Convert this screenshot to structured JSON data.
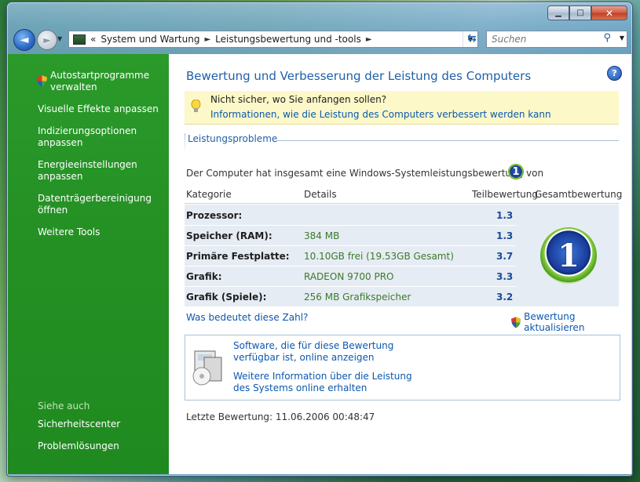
{
  "window": {
    "caption_minimize": "▁",
    "caption_maximize": "□",
    "caption_close": "✕"
  },
  "nav": {
    "back_glyph": "◄",
    "forward_glyph": "►",
    "breadcrumb_prefix": "«",
    "breadcrumbs": [
      "System und Wartung",
      "Leistungsbewertung und -tools"
    ],
    "separator": "►",
    "search_placeholder": "Suchen"
  },
  "sidebar": {
    "items": [
      "Autostartprogramme verwalten",
      "Visuelle Effekte anpassen",
      "Indizierungsoptionen anpassen",
      "Energieeinstellungen anpassen",
      "Datenträgerbereinigung öffnen",
      "Weitere Tools"
    ],
    "see_also_label": "Siehe auch",
    "see_also": [
      "Sicherheitscenter",
      "Problemlösungen"
    ]
  },
  "main": {
    "title": "Bewertung und Verbesserung der Leistung des Computers",
    "help_glyph": "?",
    "info_question": "Nicht sicher, wo Sie anfangen sollen?",
    "info_link": "Informationen, wie die Leistung des Computers verbessert werden kann",
    "section_title": "Leistungsprobleme",
    "score_text": "Der Computer hat insgesamt eine Windows-Systemleistungsbewertung von",
    "overall_score": "1",
    "columns": {
      "category": "Kategorie",
      "details": "Details",
      "subscore": "Teilbewertung",
      "base_score": "Gesamtbewertung"
    },
    "rows": [
      {
        "category": "Prozessor:",
        "details": "",
        "score": "1.3"
      },
      {
        "category": "Speicher (RAM):",
        "details": "384 MB",
        "score": "1.3"
      },
      {
        "category": "Primäre Festplatte:",
        "details": "10.10GB frei (19.53GB Gesamt)",
        "score": "3.7"
      },
      {
        "category": "Grafik:",
        "details": "RADEON 9700 PRO",
        "score": "3.3"
      },
      {
        "category": "Grafik (Spiele):",
        "details": "256 MB Grafikspeicher",
        "score": "3.2"
      }
    ],
    "what_link": "Was bedeutet diese Zahl?",
    "update_link": "Bewertung aktualisieren",
    "software_link_line1": "Software, die für diese Bewertung",
    "software_link_line2": "verfügbar ist, online anzeigen",
    "more_info_line1": "Weitere Information über die Leistung",
    "more_info_line2": "des Systems online erhalten",
    "last_rating": "Letzte Bewertung: 11.06.2006 00:48:47"
  },
  "colors": {
    "sidebar_green": "#259125",
    "link_blue": "#0a58b0",
    "title_blue": "#1f5fa8",
    "detail_green": "#3a7a28"
  }
}
